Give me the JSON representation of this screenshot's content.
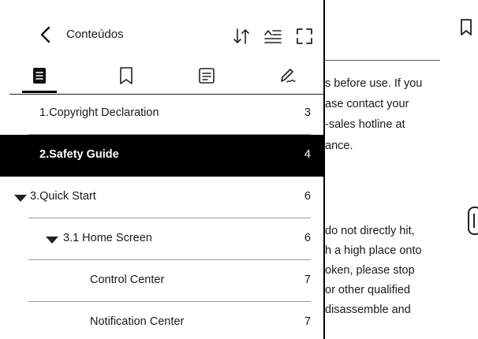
{
  "reader": {
    "lines": [
      "s before use. If you",
      "ase  contact  your",
      "-sales  hotline  at",
      "ance.",
      "do  not  directly  hit,",
      "h a high place onto",
      "oken,  please  stop",
      "  or  other  qualified",
      "disassemble  and"
    ]
  },
  "toc": {
    "title": "Conteúdos",
    "header_icons": [
      "sort-icon",
      "text-settings-icon",
      "expand-icon"
    ],
    "tabs": [
      {
        "name": "contents-tab-icon",
        "selected": true
      },
      {
        "name": "bookmarks-tab-icon",
        "selected": false
      },
      {
        "name": "notes-tab-icon",
        "selected": false
      },
      {
        "name": "annotations-tab-icon",
        "selected": false
      }
    ],
    "items": [
      {
        "label": "1.Copyright Declaration",
        "page": "3",
        "active": false,
        "expandable": false,
        "level": 0
      },
      {
        "label": "2.Safety Guide",
        "page": "4",
        "active": true,
        "expandable": false,
        "level": 0
      },
      {
        "label": "3.Quick Start",
        "page": "6",
        "active": false,
        "expandable": true,
        "level": 0
      },
      {
        "label": "3.1 Home Screen",
        "page": "6",
        "active": false,
        "expandable": true,
        "level": 1
      },
      {
        "label": "Control Center",
        "page": "7",
        "active": false,
        "expandable": false,
        "level": 2
      },
      {
        "label": "Notification Center",
        "page": "7",
        "active": false,
        "expandable": false,
        "level": 2
      }
    ]
  },
  "colors": {
    "active_row_bg": "#000000",
    "active_row_fg": "#ffffff",
    "text": "#1a1a1a",
    "divider": "#9a9a9a"
  }
}
